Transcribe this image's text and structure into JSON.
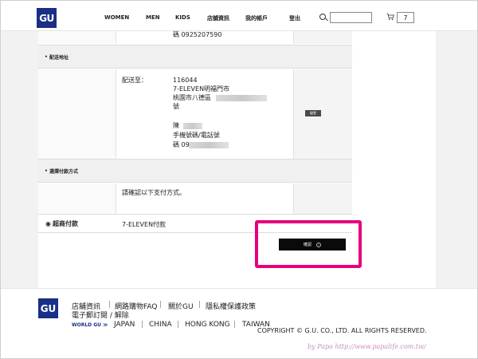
{
  "header": {
    "logo": "GU",
    "nav": [
      "WOMEN",
      "MEN",
      "KIDS",
      "店舖資訊",
      "我的帳戶",
      "登出"
    ],
    "search_value": "",
    "cart_count": "7"
  },
  "order": {
    "top_phone": "碼 0925207590",
    "shipping_section": "配送地址",
    "ship_to_label": "配送至：",
    "zip": "116044",
    "store": "7-ELEVEN明福門市",
    "address_line": "桃園市八德區",
    "address_tail": "號",
    "recipient_prefix": "陳",
    "phone_label": "手機號碼/電話號",
    "phone_prefix": "碼 09",
    "change_button": "變更",
    "payment_section": "選擇付款方式",
    "payment_note": "請確認以下支付方式。",
    "payment_method_label": "超商付款",
    "payment_method_value": "7-ELEVEN付款",
    "confirm_button": "確認"
  },
  "footer": {
    "logo": "GU",
    "links": [
      "店舖資訊",
      "網路購物FAQ",
      "關於GU",
      "隱私權保護政策"
    ],
    "link2": "電子郵訂閱 / 解除",
    "world_label": "WORLD GU ≫",
    "countries": [
      "JAPAN",
      "CHINA",
      "HONG KONG",
      "TAIWAN"
    ],
    "copyright": "COPYRIGHT © G.U. CO., LTD. ALL RIGHTS RESERVED.",
    "watermark": "by Papa  http://www.papalife.com.tw/"
  },
  "colors": {
    "brand": "#1a2f86",
    "highlight": "#e6007e",
    "button": "#0a0a0a"
  }
}
